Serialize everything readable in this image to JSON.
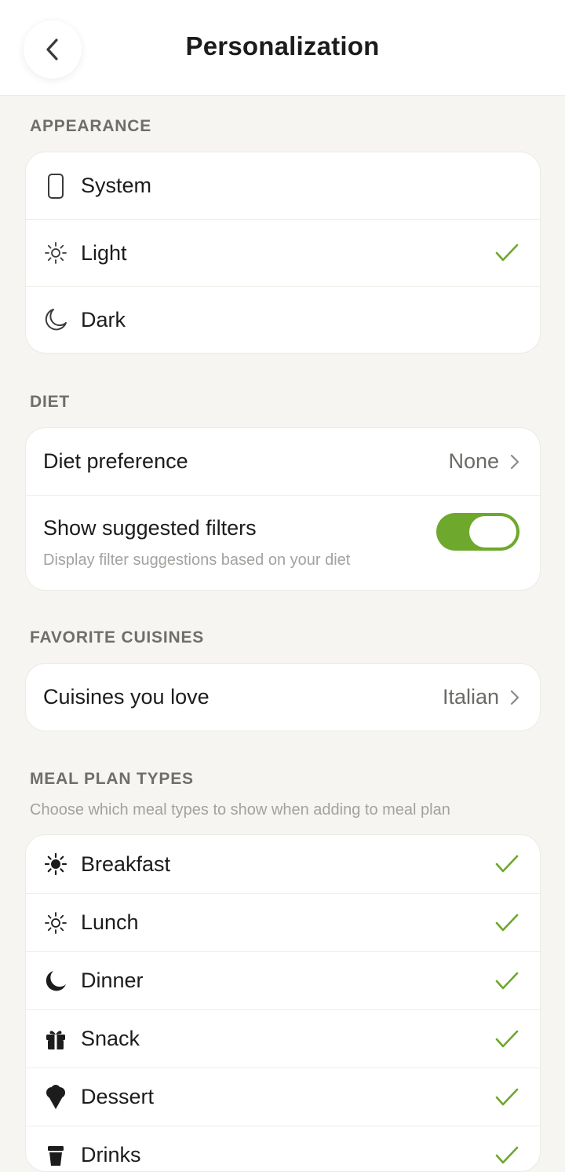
{
  "header": {
    "title": "Personalization",
    "back_icon": "chevron-left-icon"
  },
  "colors": {
    "accent": "#6ea82c",
    "background": "#f6f5f1",
    "card": "#ffffff"
  },
  "appearance": {
    "label": "APPEARANCE",
    "selected": "Light",
    "options": [
      {
        "label": "System",
        "icon": "phone-icon",
        "checked": false
      },
      {
        "label": "Light",
        "icon": "sun-outline-icon",
        "checked": true
      },
      {
        "label": "Dark",
        "icon": "moon-outline-icon",
        "checked": false
      }
    ]
  },
  "diet": {
    "label": "DIET",
    "preference_label": "Diet preference",
    "preference_value": "None",
    "filters_label": "Show suggested filters",
    "filters_sub": "Display filter suggestions based on your diet",
    "filters_on": true
  },
  "cuisines": {
    "label": "FAVORITE CUISINES",
    "row_label": "Cuisines you love",
    "row_value": "Italian"
  },
  "meal_plan": {
    "label": "MEAL PLAN TYPES",
    "sub": "Choose which meal types to show when adding to meal plan",
    "items": [
      {
        "label": "Breakfast",
        "icon": "sun-filled-icon",
        "checked": true
      },
      {
        "label": "Lunch",
        "icon": "sun-outline-icon",
        "checked": true
      },
      {
        "label": "Dinner",
        "icon": "moon-filled-icon",
        "checked": true
      },
      {
        "label": "Snack",
        "icon": "gift-icon",
        "checked": true
      },
      {
        "label": "Dessert",
        "icon": "ice-cream-icon",
        "checked": true
      },
      {
        "label": "Drinks",
        "icon": "cup-icon",
        "checked": true
      }
    ]
  }
}
